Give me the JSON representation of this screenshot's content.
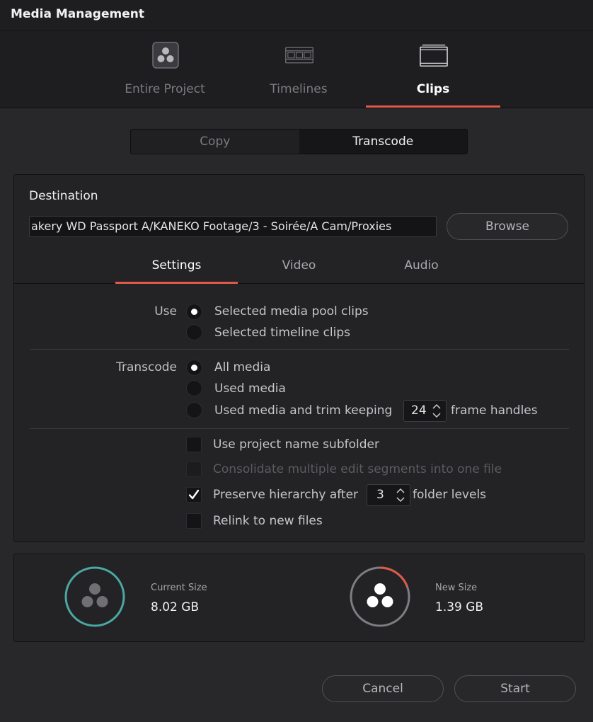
{
  "window": {
    "title": "Media Management"
  },
  "modes": [
    {
      "label": "Entire Project",
      "icon": "project-icon",
      "active": false
    },
    {
      "label": "Timelines",
      "icon": "timeline-icon",
      "active": false
    },
    {
      "label": "Clips",
      "icon": "clips-icon",
      "active": true
    }
  ],
  "operation": {
    "copy_label": "Copy",
    "transcode_label": "Transcode",
    "selected": "Transcode"
  },
  "destination": {
    "label": "Destination",
    "path": "akery WD Passport A/KANEKO Footage/3 - Soirée/A Cam/Proxies",
    "browse_label": "Browse"
  },
  "tabs": {
    "settings": "Settings",
    "video": "Video",
    "audio": "Audio",
    "active": "Settings"
  },
  "use": {
    "label": "Use",
    "options": [
      "Selected media pool clips",
      "Selected timeline clips"
    ],
    "selected": "Selected media pool clips"
  },
  "transcode": {
    "label": "Transcode",
    "options": [
      "All media",
      "Used media",
      "Used media and trim keeping"
    ],
    "selected": "All media",
    "handles_value": "24",
    "handles_suffix": "frame handles"
  },
  "checkboxes": {
    "project_subfolder": {
      "label": "Use project name subfolder",
      "checked": false
    },
    "consolidate": {
      "label": "Consolidate multiple edit segments into one file",
      "checked": false,
      "disabled": true
    },
    "preserve_hierarchy": {
      "label": "Preserve hierarchy after",
      "checked": true,
      "levels_value": "3",
      "levels_suffix": "folder levels"
    },
    "relink": {
      "label": "Relink to new files",
      "checked": false
    }
  },
  "sizes": {
    "current": {
      "label": "Current Size",
      "value": "8.02 GB",
      "ring_color": "#4aa7a2"
    },
    "new": {
      "label": "New Size",
      "value": "1.39 GB",
      "ring_color": "#7d7d82",
      "accent_color": "#e0584a"
    }
  },
  "footer": {
    "cancel_label": "Cancel",
    "start_label": "Start"
  },
  "colors": {
    "accent": "#e0584a",
    "background": "#28282b"
  }
}
